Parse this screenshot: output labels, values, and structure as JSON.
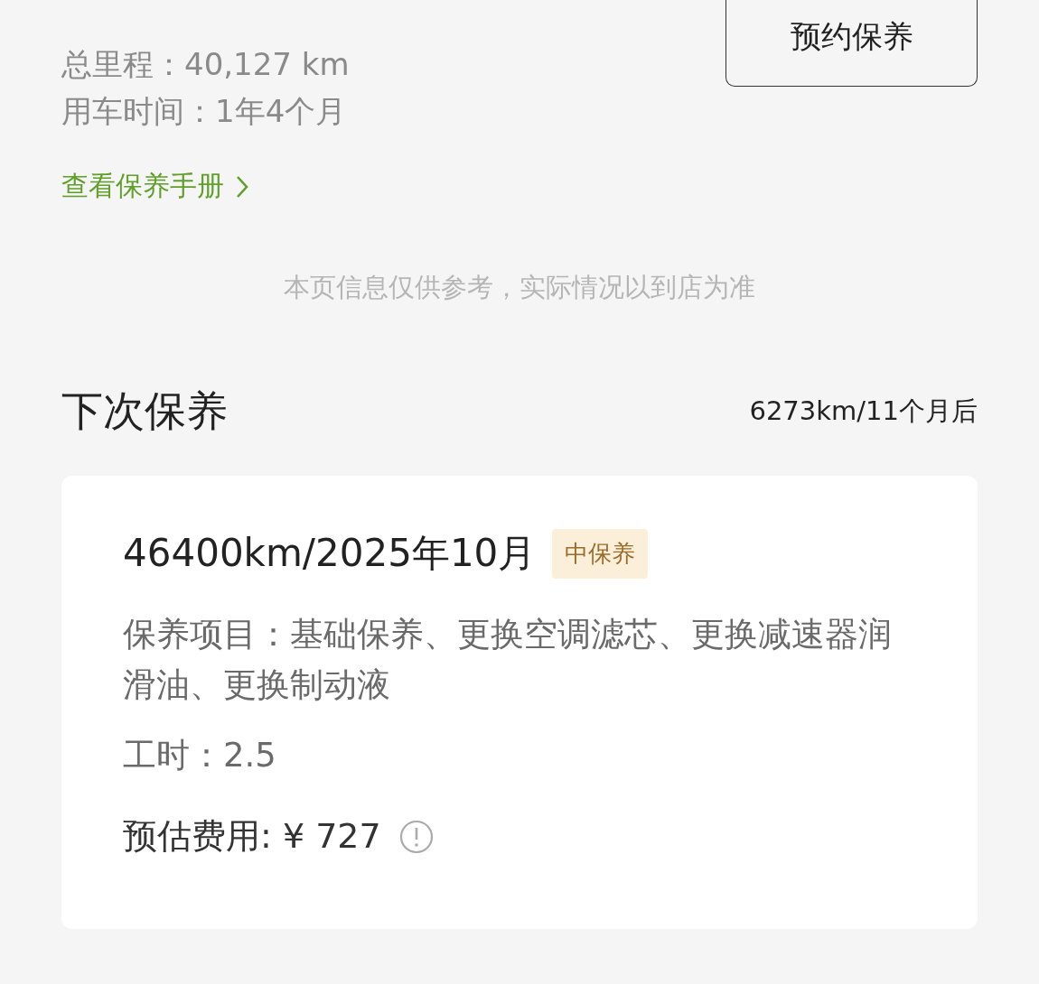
{
  "summary": {
    "lines": [
      "总里程：40,127 km",
      "用车时间：1年4个月"
    ],
    "book_button": "预约保养",
    "manual_link": "查看保养手册"
  },
  "notice": "本页信息仅供参考，实际情况以到店为准",
  "next_service": {
    "title": "下次保养",
    "remaining": "6273km/11个月后",
    "card": {
      "title": "46400km/2025年10月",
      "badge": "中保养",
      "items": "保养项目：基础保养、更换空调滤芯、更换减速器润滑油、更换制动液",
      "hours": "工时：2.5",
      "cost": "预估费用: ¥ 727"
    }
  }
}
